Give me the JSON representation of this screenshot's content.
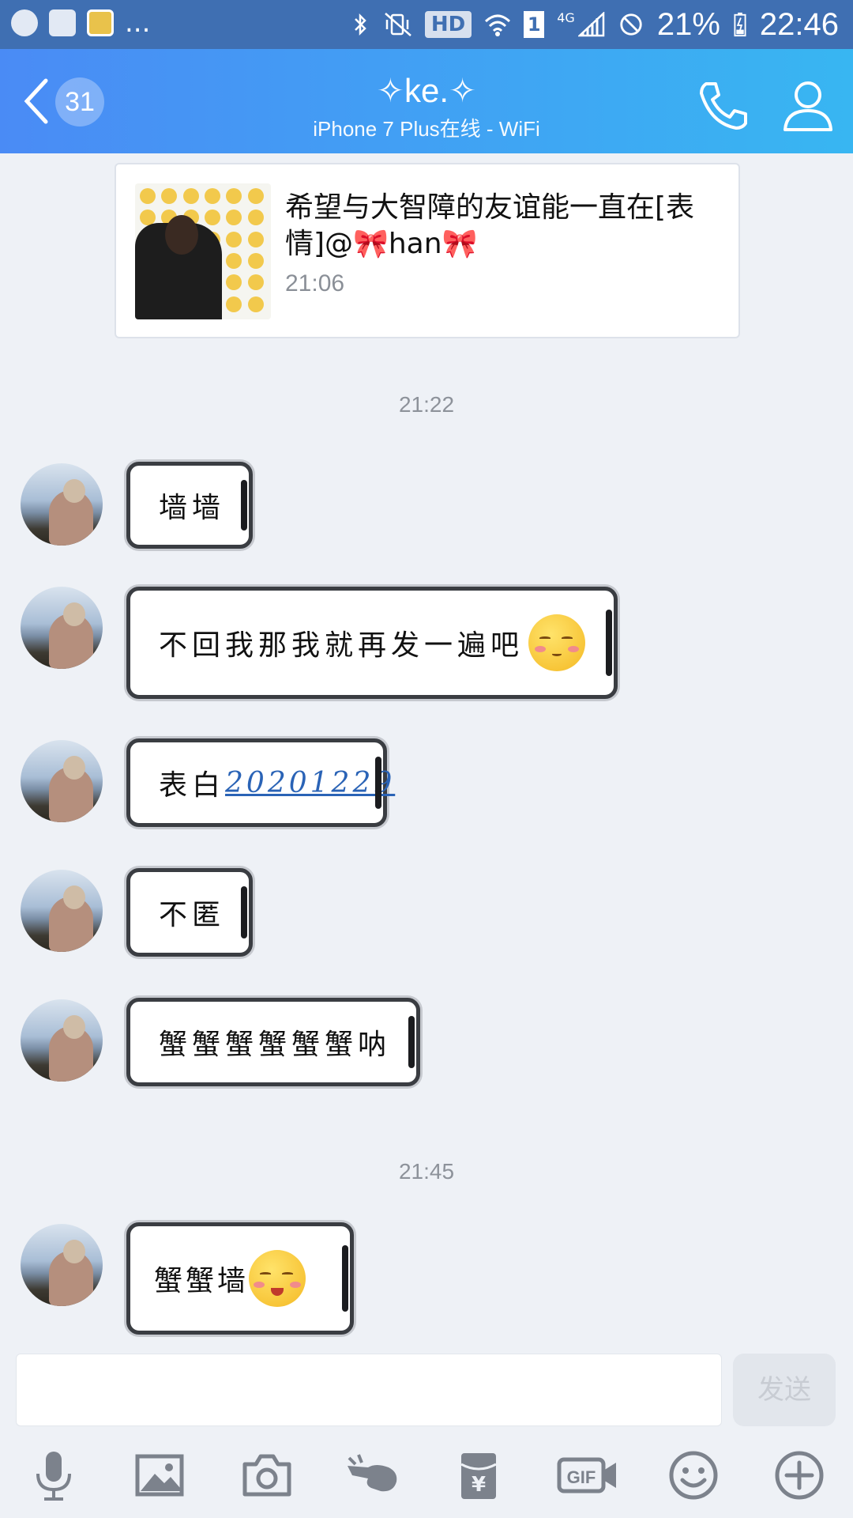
{
  "status_bar": {
    "overflow_dots": "...",
    "hd_label": "HD",
    "sim_slot": "1",
    "network_label": "4G",
    "battery_percent": "21%",
    "clock": "22:46"
  },
  "header": {
    "unread_count": "31",
    "title": "✧ke.✧",
    "subtitle": "iPhone 7 Plus在线 - WiFi"
  },
  "pinned_card": {
    "text": "希望与大智障的友谊能一直在[表情]@🎀han🎀",
    "time": "21:06"
  },
  "time_separators": [
    "21:22",
    "21:45"
  ],
  "messages": [
    {
      "text": "墙墙"
    },
    {
      "text": "不回我那我就再发一遍吧",
      "emoji": "shy-smile-emoji"
    },
    {
      "prefix": "表白",
      "link": "20201229"
    },
    {
      "text": "不匿"
    },
    {
      "text": "蟹蟹蟹蟹蟹蟹呐"
    },
    {
      "text": "蟹蟹墙",
      "emoji": "happy-blush-emoji"
    }
  ],
  "input": {
    "placeholder": "",
    "send_label": "发送"
  },
  "toolbar": {
    "icons": [
      "microphone-icon",
      "image-icon",
      "camera-icon",
      "poke-icon",
      "red-packet-icon",
      "gif-icon",
      "emoji-icon",
      "plus-icon"
    ],
    "red_packet_symbol": "¥",
    "gif_label": "GIF"
  },
  "colors": {
    "header_start": "#4a8bf5",
    "header_end": "#38b6f2",
    "status_bar": "#3f6fb2",
    "background": "#eef1f6",
    "link": "#2a63b6"
  }
}
